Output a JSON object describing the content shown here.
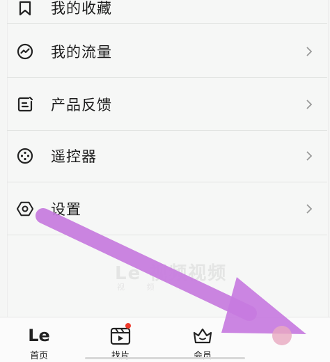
{
  "menu": {
    "partial_item": "我的收藏",
    "items": [
      {
        "key": "traffic",
        "label": "我的流量",
        "icon": "trend-icon"
      },
      {
        "key": "feedback",
        "label": "产品反馈",
        "icon": "feedback-icon"
      },
      {
        "key": "remote",
        "label": "遥控器",
        "icon": "remote-icon"
      },
      {
        "key": "settings",
        "label": "设置",
        "icon": "gear-icon"
      }
    ]
  },
  "watermark": {
    "text": "Le 视频视频",
    "subtext": "视 频 平"
  },
  "tabbar": {
    "tabs": [
      {
        "label": "首页",
        "icon": "le-logo-icon"
      },
      {
        "label": "找片",
        "icon": "clapper-icon",
        "badge": true
      },
      {
        "label": "会员",
        "icon": "crown-icon"
      }
    ]
  },
  "colors": {
    "arrow": "#c77bdf",
    "badge": "#ee3a2c",
    "text": "#1b1b1b"
  }
}
